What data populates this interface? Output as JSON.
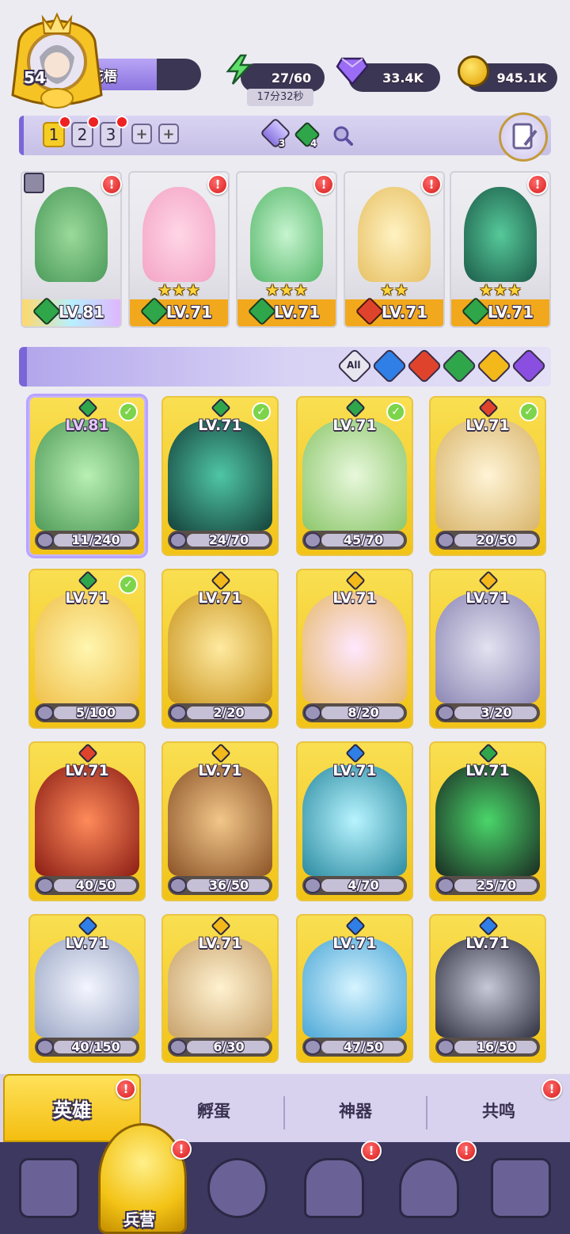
{
  "player": {
    "level": "54",
    "name": "花梧"
  },
  "resources": {
    "energy": "27/60",
    "energy_timer": "17分32秒",
    "gems": "33.4K",
    "gold": "945.1K"
  },
  "teams": {
    "tabs": [
      "1",
      "2",
      "3"
    ],
    "crystal_count": "3",
    "green_count": "4"
  },
  "team_row": [
    {
      "level": "LV.81",
      "element": "green"
    },
    {
      "level": "LV.71",
      "element": "green"
    },
    {
      "level": "LV.71",
      "element": "green"
    },
    {
      "level": "LV.71",
      "element": "red"
    },
    {
      "level": "LV.71",
      "element": "green"
    }
  ],
  "filter": {
    "all": "All",
    "elements": [
      "water",
      "fire",
      "wood",
      "light",
      "dark"
    ]
  },
  "heroes": [
    {
      "level": "LV.81",
      "shards": "11/240",
      "element": "green"
    },
    {
      "level": "LV.71",
      "shards": "24/70",
      "element": "green"
    },
    {
      "level": "LV.71",
      "shards": "45/70",
      "element": "green"
    },
    {
      "level": "LV.71",
      "shards": "20/50",
      "element": "red"
    },
    {
      "level": "LV.71",
      "shards": "5/100",
      "element": "green"
    },
    {
      "level": "LV.71",
      "shards": "2/20",
      "element": "gold"
    },
    {
      "level": "LV.71",
      "shards": "8/20",
      "element": "gold"
    },
    {
      "level": "LV.71",
      "shards": "3/20",
      "element": "gold"
    },
    {
      "level": "LV.71",
      "shards": "40/50",
      "element": "red"
    },
    {
      "level": "LV.71",
      "shards": "36/50",
      "element": "gold"
    },
    {
      "level": "LV.71",
      "shards": "4/70",
      "element": "blue"
    },
    {
      "level": "LV.71",
      "shards": "25/70",
      "element": "green"
    },
    {
      "level": "LV.71",
      "shards": "40/150",
      "element": "blue"
    },
    {
      "level": "LV.71",
      "shards": "6/30",
      "element": "gold"
    },
    {
      "level": "LV.71",
      "shards": "47/50",
      "element": "blue"
    },
    {
      "level": "LV.71",
      "shards": "16/50",
      "element": "blue"
    }
  ],
  "sub_tabs": [
    "英雄",
    "孵蛋",
    "神器",
    "共鸣"
  ],
  "bottom_nav": {
    "active_label": "兵营",
    "icons": [
      "cards-icon",
      "barracks-icon",
      "map-icon",
      "temple-icon",
      "mushroom-icon",
      "guild-icon"
    ]
  },
  "badges": {
    "alert": "!"
  },
  "colors": {
    "accent": "#7b66d8",
    "gold": "#f3c316",
    "nav": "#3d3860"
  }
}
